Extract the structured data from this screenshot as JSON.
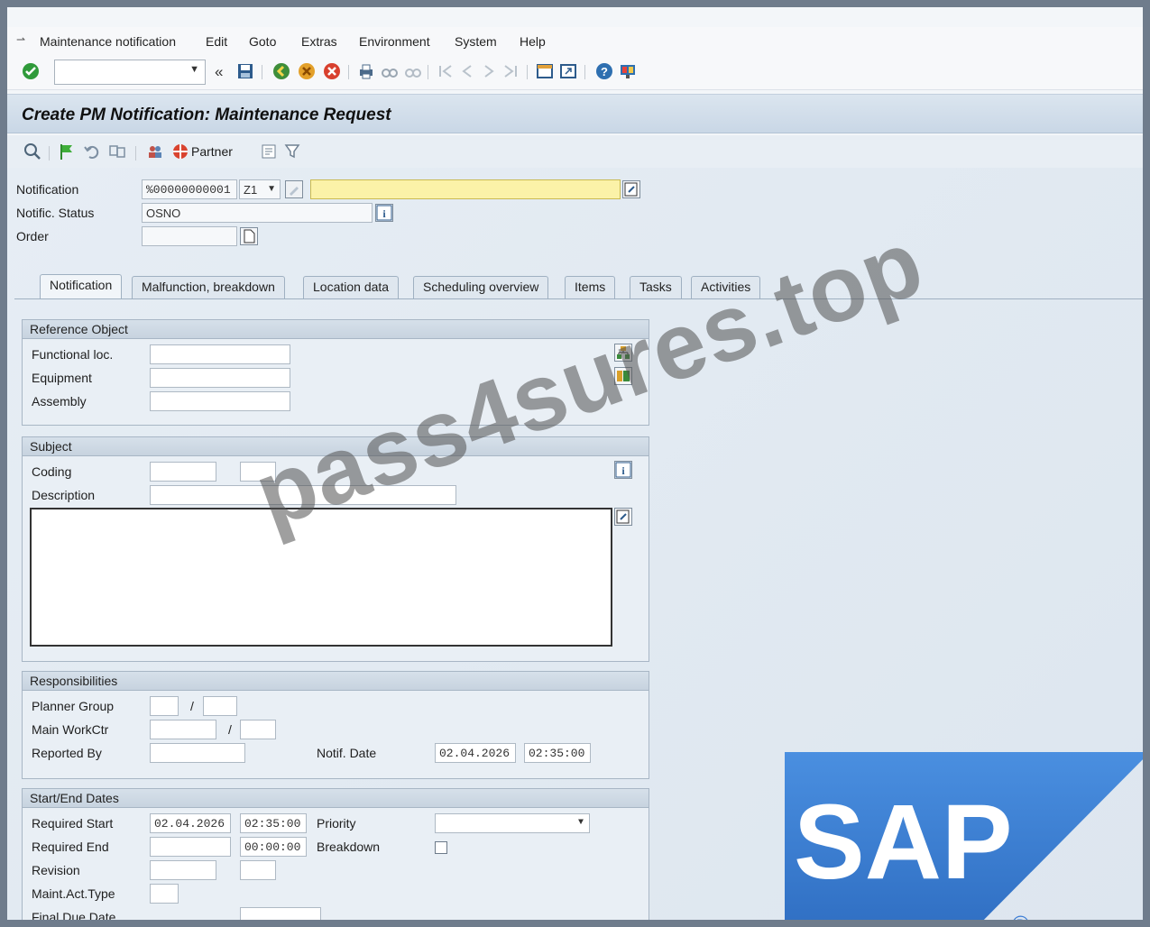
{
  "menubar": {
    "items": [
      "Maintenance notification",
      "Edit",
      "Goto",
      "Extras",
      "Environment",
      "System",
      "Help"
    ]
  },
  "toolbar": {
    "command_value": "",
    "icons": [
      "enter-icon",
      "back-icon",
      "save-icon",
      "back-nav-icon",
      "exit-icon",
      "cancel-icon",
      "print-icon",
      "find-icon",
      "find-next-icon",
      "first-page-icon",
      "prev-page-icon",
      "next-page-icon",
      "last-page-icon",
      "new-session-icon",
      "shortcut-icon",
      "help-icon",
      "customize-layout-icon"
    ]
  },
  "title": "Create PM Notification: Maintenance Request",
  "apptoolbar": {
    "partner_label": "Partner"
  },
  "header": {
    "notification_label": "Notification",
    "notification_value": "%00000000001",
    "notification_type": "Z1",
    "status_label": "Notific. Status",
    "status_value": "OSNO",
    "order_label": "Order",
    "order_value": ""
  },
  "tabs": [
    "Notification",
    "Malfunction, breakdown",
    "Location data",
    "Scheduling overview",
    "Items",
    "Tasks",
    "Activities"
  ],
  "reference_object": {
    "title": "Reference Object",
    "functional_loc_label": "Functional loc.",
    "equipment_label": "Equipment",
    "assembly_label": "Assembly"
  },
  "subject": {
    "title": "Subject",
    "coding_label": "Coding",
    "description_label": "Description"
  },
  "responsibilities": {
    "title": "Responsibilities",
    "planner_group_label": "Planner Group",
    "main_workctr_label": "Main WorkCtr",
    "reported_by_label": "Reported By",
    "notif_date_label": "Notif. Date",
    "notif_date_value": "02.04.2026",
    "notif_time_value": "02:35:00",
    "slash": "/"
  },
  "start_end": {
    "title": "Start/End Dates",
    "required_start_label": "Required Start",
    "required_start_date": "02.04.2026",
    "required_start_time": "02:35:00",
    "priority_label": "Priority",
    "required_end_label": "Required End",
    "required_end_time": "00:00:00",
    "breakdown_label": "Breakdown",
    "revision_label": "Revision",
    "maint_act_type_label": "Maint.Act.Type",
    "final_due_date_label": "Final Due Date"
  },
  "watermark": "pass4sures.top",
  "logo": {
    "text": "SAP",
    "registered": "®",
    "color": "#3a7bd5"
  }
}
